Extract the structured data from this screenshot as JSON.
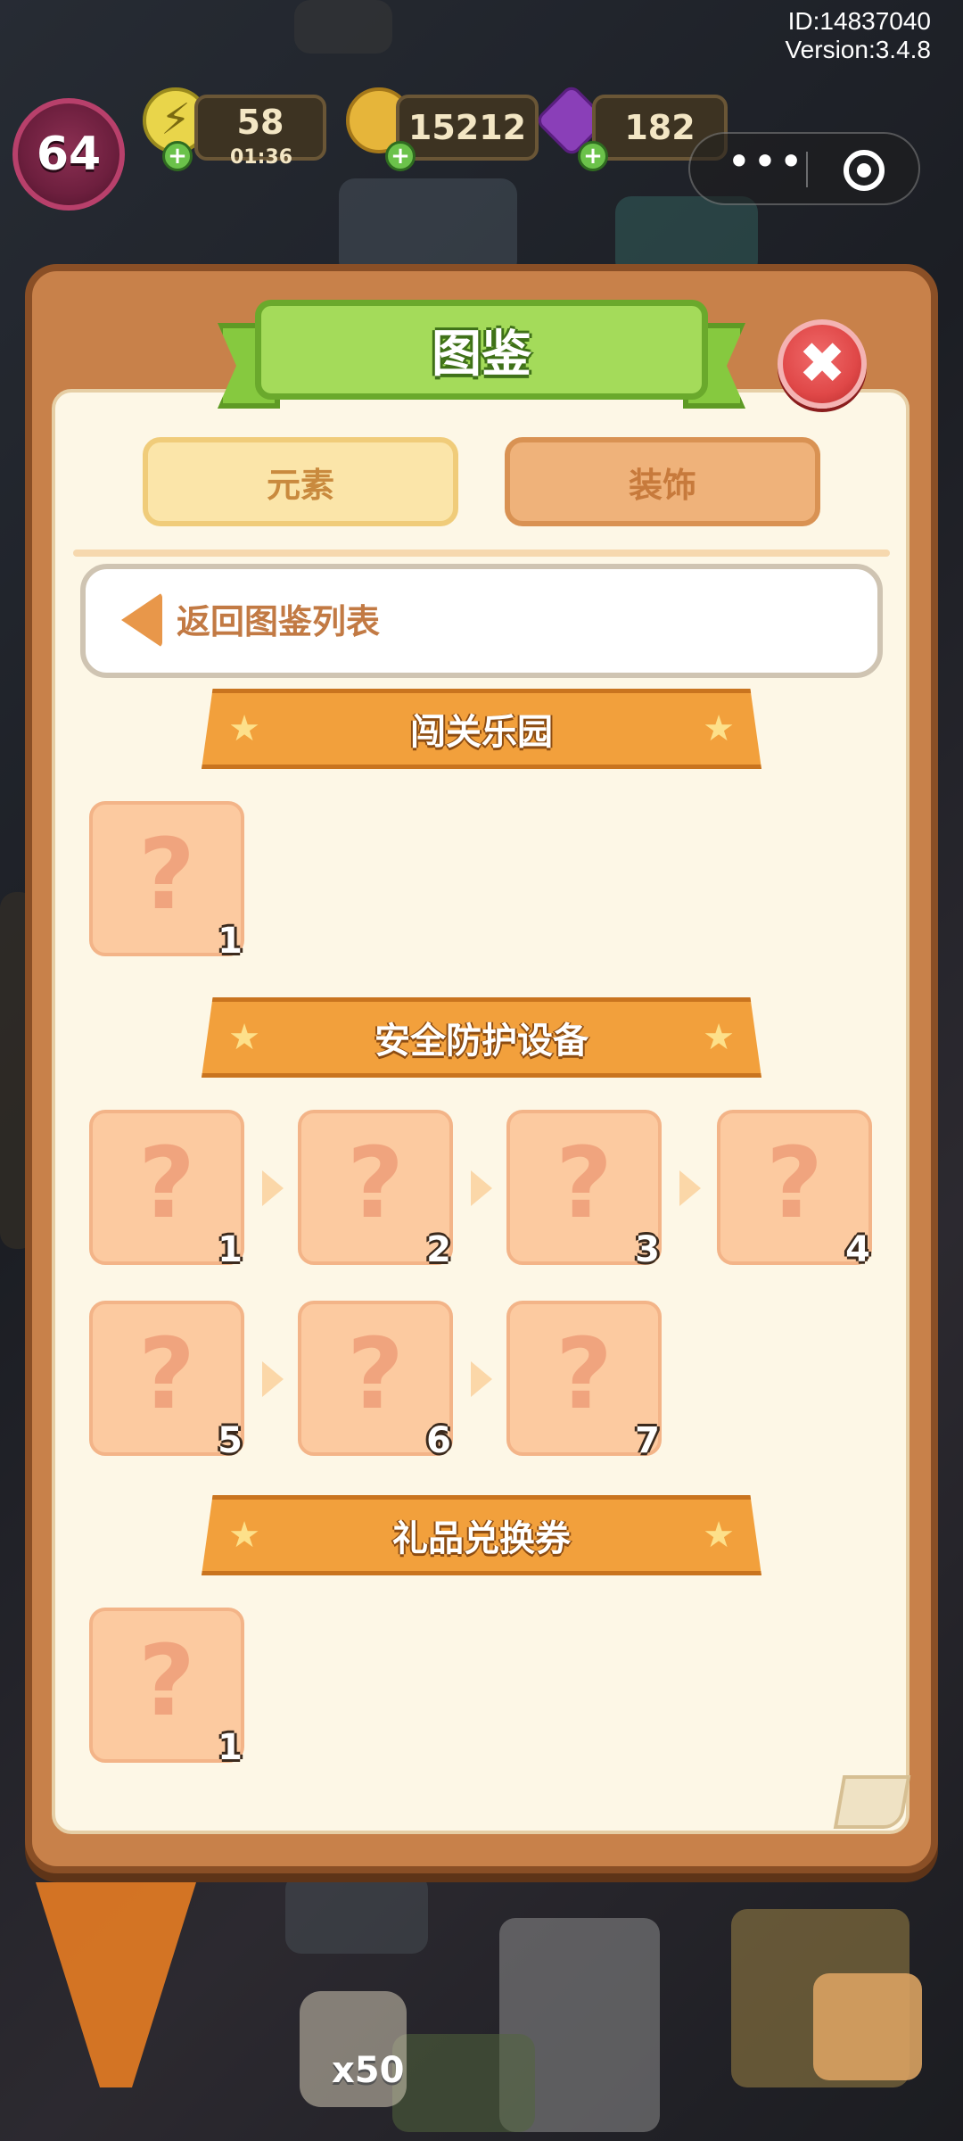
{
  "status": {
    "id_text": "ID:14837040",
    "version_text": "Version:3.4.8"
  },
  "hud": {
    "level": "64",
    "energy": "58",
    "energy_timer": "01:36",
    "coins": "15212",
    "gems": "182"
  },
  "dialog": {
    "title": "图鉴",
    "close_symbol": "✖",
    "tabs": [
      {
        "label": "元素",
        "selected": true
      },
      {
        "label": "装饰",
        "selected": false
      }
    ],
    "back_label": "返回图鉴列表",
    "sections": [
      {
        "title": "闯关乐园",
        "items": [
          "1"
        ]
      },
      {
        "title": "安全防护设备",
        "items": [
          "1",
          "2",
          "3",
          "4",
          "5",
          "6",
          "7"
        ]
      },
      {
        "title": "礼品兑换券",
        "items": [
          "1"
        ]
      }
    ],
    "unknown_glyph": "?"
  },
  "bottom_bar": {
    "clover_count": "x50"
  },
  "colors": {
    "panel": "#c8814a",
    "panel_inner": "#fdf7e6",
    "title_green": "#a4db5a",
    "section_orange": "#f2a03c",
    "tile": "#fccaa0",
    "close_red": "#e04848"
  }
}
